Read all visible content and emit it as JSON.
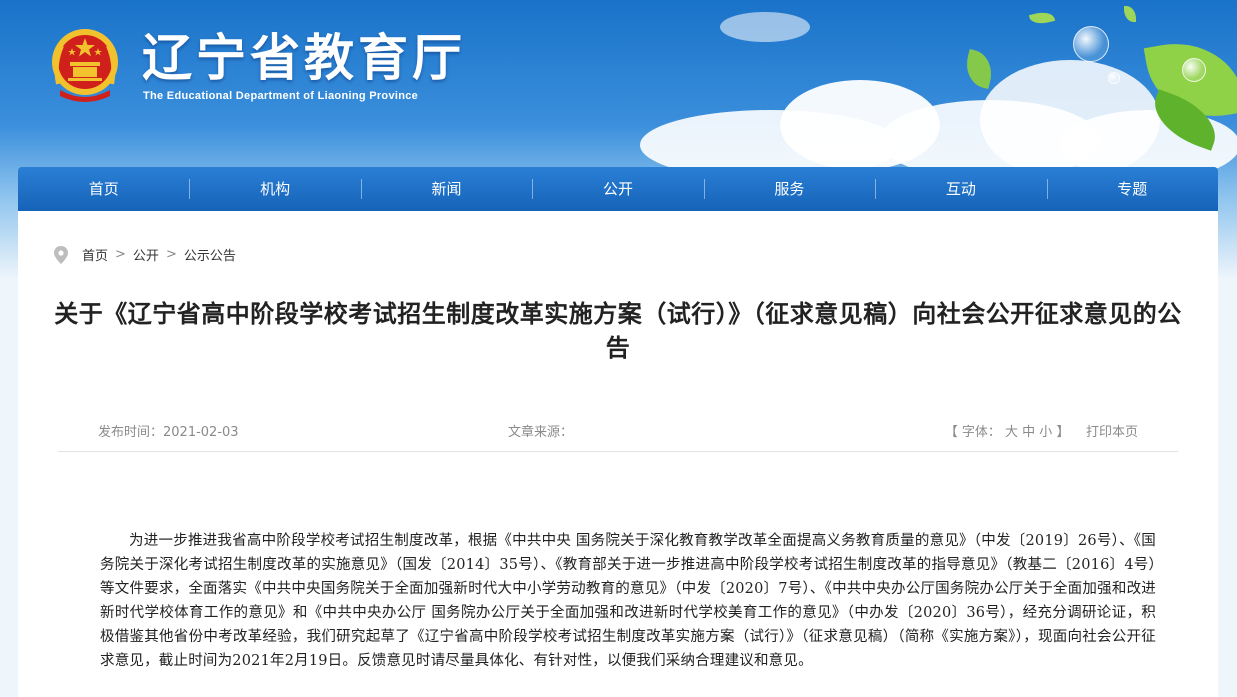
{
  "header": {
    "title": "辽宁省教育厅",
    "subtitle": "The Educational Department of Liaoning Province"
  },
  "nav": {
    "items": [
      "首页",
      "机构",
      "新闻",
      "公开",
      "服务",
      "互动",
      "专题"
    ]
  },
  "breadcrumb": {
    "items": [
      "首页",
      "公开",
      "公示公告"
    ],
    "separator": ">"
  },
  "article": {
    "title": "关于《辽宁省高中阶段学校考试招生制度改革实施方案（试行）》（征求意见稿）向社会公开征求意见的公告",
    "publish_time": "发布时间：2021-02-03",
    "source": "文章来源：",
    "font_label_open": "【 字体：",
    "font_large": "大",
    "font_medium": "中",
    "font_small": "小",
    "font_label_close": "】",
    "print": "打印本页",
    "body": "为进一步推进我省高中阶段学校考试招生制度改革，根据《中共中央 国务院关于深化教育教学改革全面提高义务教育质量的意见》（中发〔2019〕26号）、《国务院关于深化考试招生制度改革的实施意见》（国发〔2014〕35号）、《教育部关于进一步推进高中阶段学校考试招生制度改革的指导意见》（教基二〔2016〕4号）等文件要求，全面落实《中共中央国务院关于全面加强新时代大中小学劳动教育的意见》（中发〔2020〕7号）、《中共中央办公厅国务院办公厅关于全面加强和改进新时代学校体育工作的意见》和《中共中央办公厅 国务院办公厅关于全面加强和改进新时代学校美育工作的意见》（中办发〔2020〕36号），经充分调研论证，积极借鉴其他省份中考改革经验，我们研究起草了《辽宁省高中阶段学校考试招生制度改革实施方案（试行）》（征求意见稿）（简称《实施方案》），现面向社会公开征求意见，截止时间为2021年2月19日。反馈意见时请尽量具体化、有针对性，以便我们采纳合理建议和意见。"
  },
  "colors": {
    "nav_bg": "#1563b9",
    "header_sky": "#1a73c9",
    "emblem_red": "#d0201b",
    "emblem_gold": "#f2c12e"
  }
}
